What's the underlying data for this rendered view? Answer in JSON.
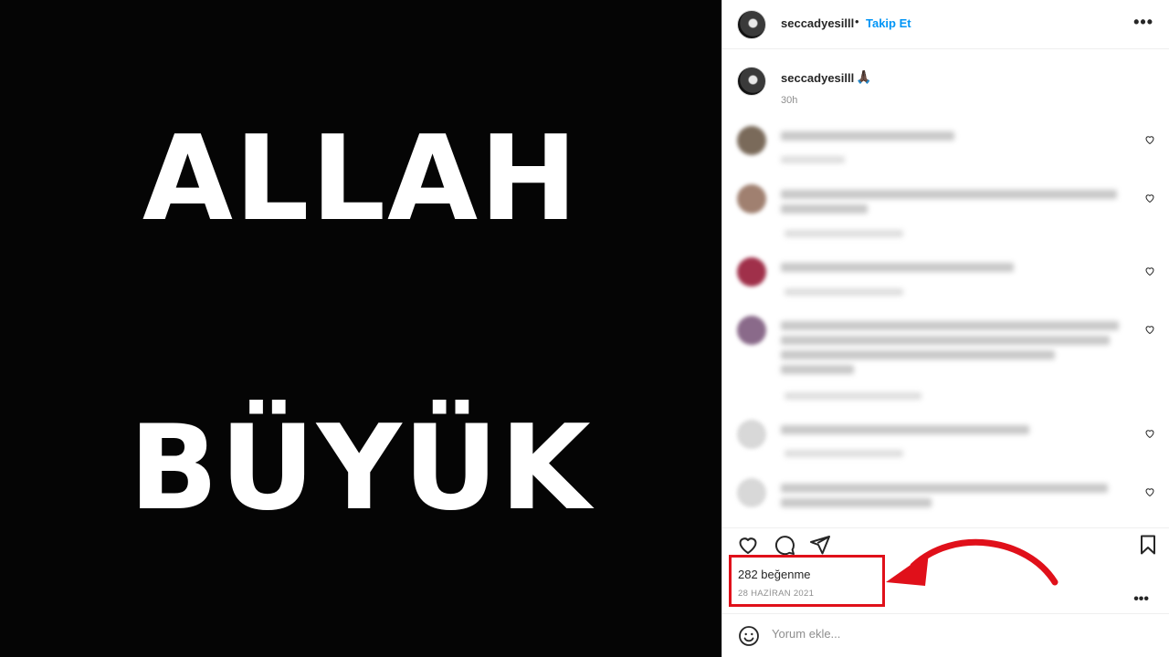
{
  "post": {
    "image_text": [
      "ALLAH",
      "BÜYÜK"
    ]
  },
  "header": {
    "username": "seccadyesilll",
    "separator": "•",
    "follow_label": "Takip Et",
    "more_icon": "more-horizontal-icon"
  },
  "caption": {
    "username": "seccadyesilll",
    "emoji": "🙏🏿",
    "time": "30h"
  },
  "actions": {
    "icons": [
      "heart-icon",
      "comment-icon",
      "share-icon",
      "bookmark-icon"
    ],
    "likes": "282 beğenme",
    "date": "28 HAZİRAN 2021"
  },
  "comment_box": {
    "placeholder": "Yorum ekle..."
  },
  "colors": {
    "accent": "#0095f6",
    "highlight": "#e0101a"
  }
}
